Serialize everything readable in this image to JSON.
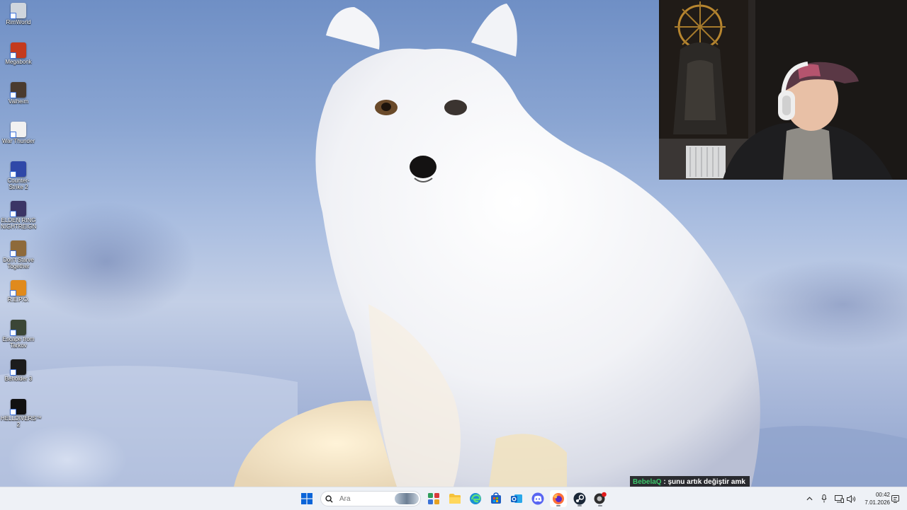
{
  "desktop": {
    "icons": [
      {
        "label": "RimWorld",
        "icon": "rimworld-icon",
        "color": "#cfd5dd"
      },
      {
        "label": "Megabonk",
        "icon": "megabonk-icon",
        "color": "#c43a1e"
      },
      {
        "label": "Valheim",
        "icon": "valheim-icon",
        "color": "#4a3b2f"
      },
      {
        "label": "War Thunder",
        "icon": "war-thunder-icon",
        "color": "#f1f1f1"
      },
      {
        "label": "Counter-Strike 2",
        "icon": "counter-strike-icon",
        "color": "#2f48a8"
      },
      {
        "label": "ELDEN RING NIGHTREIGN",
        "icon": "elden-ring-icon",
        "color": "#3b3566"
      },
      {
        "label": "Don't Starve Together",
        "icon": "dont-starve-icon",
        "color": "#8e6a3b"
      },
      {
        "label": "R.E.P.O.",
        "icon": "repo-icon",
        "color": "#e08a1c"
      },
      {
        "label": "Escape from Tarkov",
        "icon": "tarkov-icon",
        "color": "#3b4636"
      },
      {
        "label": "Beholder 3",
        "icon": "beholder-icon",
        "color": "#1c1c1c"
      },
      {
        "label": "HELLDIVERS™ 2",
        "icon": "helldivers-icon",
        "color": "#111111"
      }
    ]
  },
  "chat": {
    "username": "BebelaQ",
    "separator": " : ",
    "message": "şunu artık değiştir amk"
  },
  "taskbar": {
    "search_placeholder": "Ara",
    "apps": [
      {
        "name": "widgets",
        "icon": "widgets-icon"
      },
      {
        "name": "file-explorer",
        "icon": "folder-icon"
      },
      {
        "name": "edge",
        "icon": "edge-icon"
      },
      {
        "name": "microsoft-store",
        "icon": "store-icon"
      },
      {
        "name": "outlook",
        "icon": "outlook-icon"
      },
      {
        "name": "discord",
        "icon": "discord-icon"
      },
      {
        "name": "firefox",
        "icon": "firefox-icon"
      },
      {
        "name": "steam",
        "icon": "steam-icon"
      },
      {
        "name": "app-with-badge",
        "icon": "notification-app-icon"
      }
    ],
    "clock": {
      "time": "00:42",
      "date": "7.01.2026"
    }
  },
  "colors": {
    "taskbar_bg": "#eef1f6",
    "chat_user": "#3cc76b",
    "windows_blue": "#0a64d8"
  }
}
